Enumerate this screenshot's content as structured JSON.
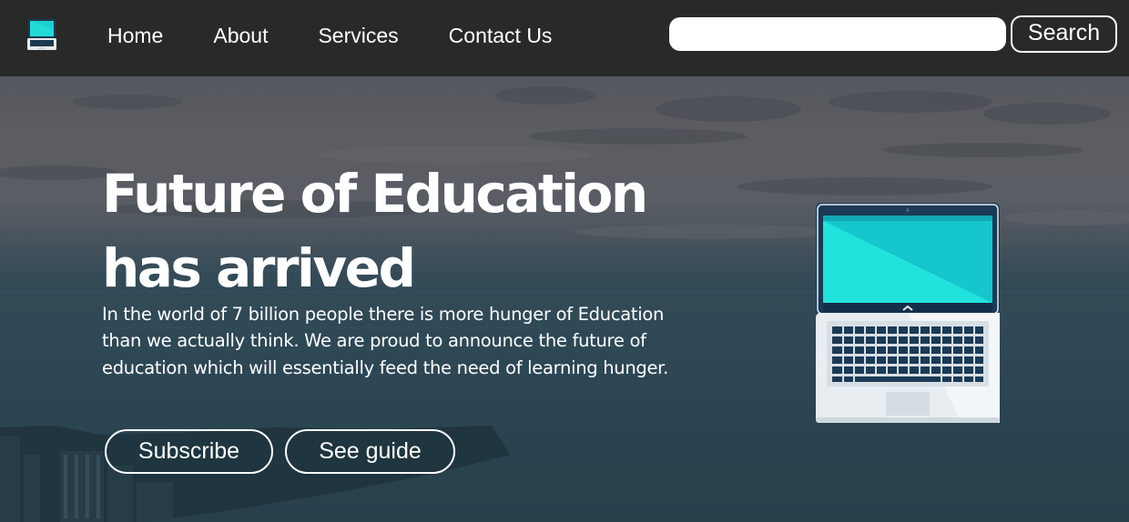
{
  "nav": {
    "links": [
      "Home",
      "About",
      "Services",
      "Contact Us"
    ],
    "search_placeholder": "",
    "search_value": "",
    "search_button": "Search"
  },
  "hero": {
    "title": "Future of Education has arrived",
    "text": "In the world of 7 billion people there is more hunger of Education than we actually think. We are proud to announce the future of education which will essentially feed the need of learning hunger.",
    "buttons": {
      "subscribe": "Subscribe",
      "guide": "See guide"
    }
  },
  "icons": {
    "logo": "laptop-icon",
    "illustration": "laptop-illustration"
  },
  "colors": {
    "navbar": "#282828",
    "text": "#ffffff",
    "screen_accent": "#1ecfd0"
  }
}
